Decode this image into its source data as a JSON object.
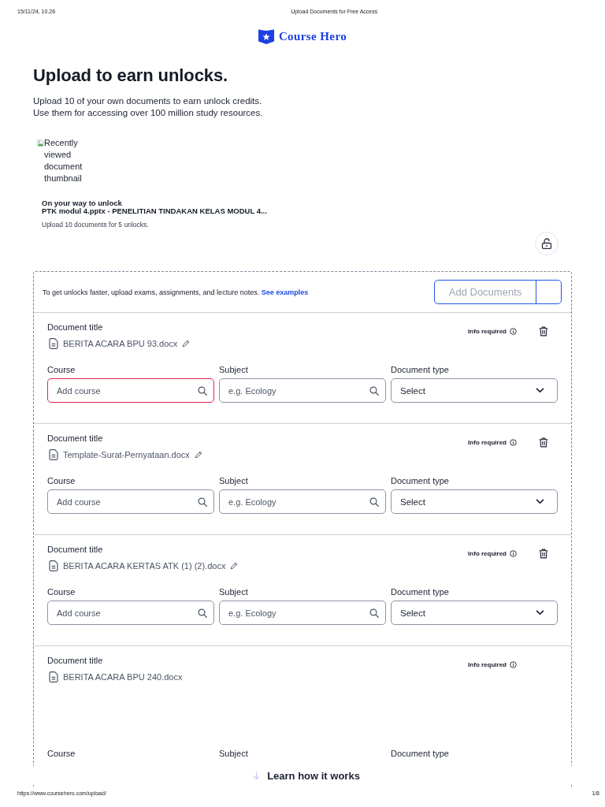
{
  "print_header": {
    "date": "15/11/24, 10.26",
    "title": "Upload Documents for Free Access"
  },
  "brand": {
    "name": "Course Hero"
  },
  "heading": "Upload to earn unlocks.",
  "intro": [
    "Upload 10 of your own documents to earn unlock credits.",
    "Use them for accessing over 100 million study resources."
  ],
  "progress_card": {
    "thumbnail_alt": "Recently viewed document thumbnail",
    "eyebrow": "On your way to unlock",
    "document": "PTK modul 4.pptx - PENELITIAN TINDAKAN KELAS MODUL 4...",
    "note": "Upload 10 documents for 5 unlocks."
  },
  "uploader": {
    "tip": "To get unlocks faster, upload exams, assignments, and lecture notes.",
    "tip_link": "See examples",
    "add_button": {
      "label": "Add Documents",
      "disabled": true
    }
  },
  "documents": [
    {
      "title_label": "Document title",
      "file_name": "BERITA ACARA BPU 93.docx",
      "editable": true,
      "status": "Info required",
      "deletable": true,
      "fields": [
        {
          "kind": "search",
          "label": "Course",
          "placeholder": "Add course",
          "error": true
        },
        {
          "kind": "search",
          "label": "Subject",
          "placeholder": "e.g. Ecology",
          "error": false
        },
        {
          "kind": "select",
          "label": "Document type",
          "value": "Select",
          "error": false
        }
      ]
    },
    {
      "title_label": "Document title",
      "file_name": "Template-Surat-Pernyataan.docx",
      "editable": true,
      "status": "Info required",
      "deletable": true,
      "fields": [
        {
          "kind": "search",
          "label": "Course",
          "placeholder": "Add course",
          "error": false
        },
        {
          "kind": "search",
          "label": "Subject",
          "placeholder": "e.g. Ecology",
          "error": false
        },
        {
          "kind": "select",
          "label": "Document type",
          "value": "Select",
          "error": false
        }
      ]
    },
    {
      "title_label": "Document title",
      "file_name": "BERITA ACARA KERTAS ATK (1) (2).docx",
      "editable": true,
      "status": "Info required",
      "deletable": true,
      "fields": [
        {
          "kind": "search",
          "label": "Course",
          "placeholder": "Add course",
          "error": false
        },
        {
          "kind": "search",
          "label": "Subject",
          "placeholder": "e.g. Ecology",
          "error": false
        },
        {
          "kind": "select",
          "label": "Document type",
          "value": "Select",
          "error": false
        }
      ]
    },
    {
      "title_label": "Document title",
      "file_name": "BERITA ACARA BPU 240.docx",
      "editable": false,
      "status": "Info required",
      "deletable": false,
      "fields": [
        {
          "label": "Course"
        },
        {
          "label": "Subject"
        },
        {
          "label": "Document type"
        }
      ]
    }
  ],
  "learn_more": "Learn how it works",
  "print_footer": {
    "url": "https://www.coursehero.com/upload/",
    "page": "1/8"
  }
}
